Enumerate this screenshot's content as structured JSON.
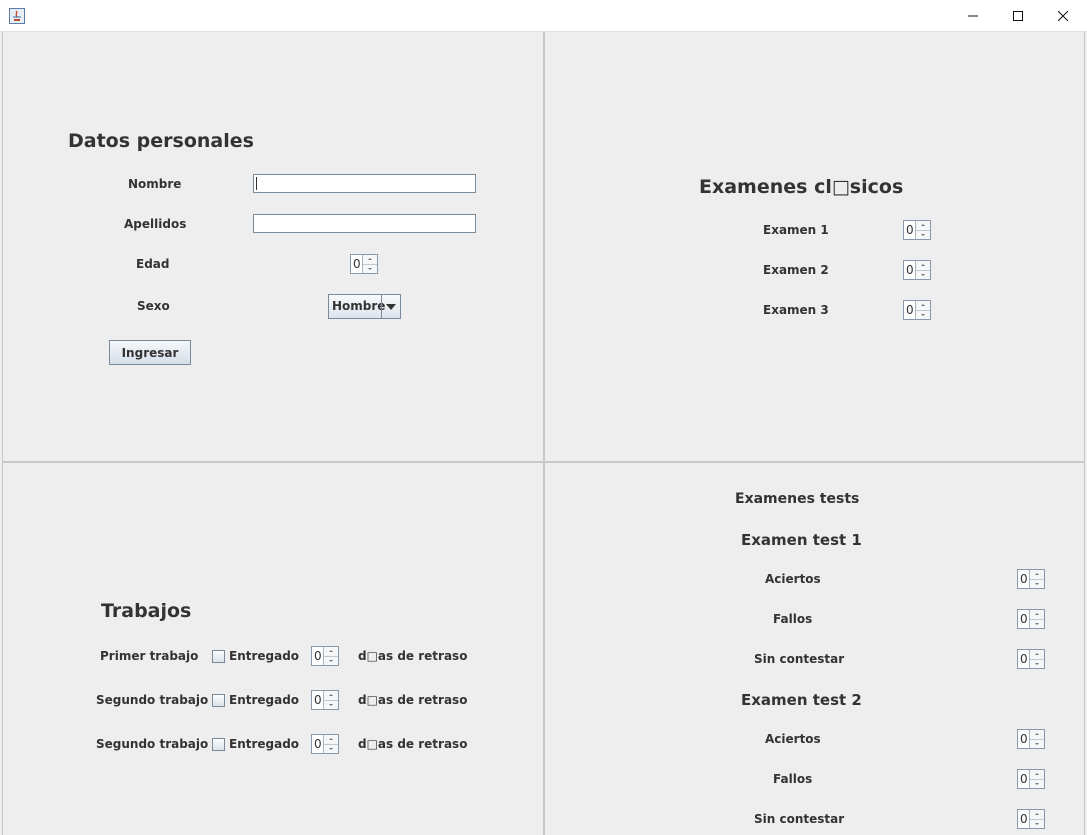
{
  "window": {
    "minimize_icon": "minimize-icon",
    "maximize_icon": "maximize-icon",
    "close_icon": "close-icon"
  },
  "datos": {
    "title": "Datos personales",
    "nombre_label": "Nombre",
    "nombre_value": "",
    "apellidos_label": "Apellidos",
    "apellidos_value": "",
    "edad_label": "Edad",
    "edad_value": "0",
    "sexo_label": "Sexo",
    "sexo_value": "Hombre",
    "ingresar_label": "Ingresar"
  },
  "clasicos": {
    "title": "Examenes cl□sicos",
    "items": [
      {
        "label": "Examen 1",
        "value": "0"
      },
      {
        "label": "Examen 2",
        "value": "0"
      },
      {
        "label": "Examen 3",
        "value": "0"
      }
    ]
  },
  "trabajos": {
    "title": "Trabajos",
    "rows": [
      {
        "label": "Primer trabajo",
        "check_label": "Entregado",
        "checked": false,
        "value": "0",
        "suffix": "d□as de retraso"
      },
      {
        "label": "Segundo trabajo",
        "check_label": "Entregado",
        "checked": false,
        "value": "0",
        "suffix": "d□as de retraso"
      },
      {
        "label": "Segundo trabajo",
        "check_label": "Entregado",
        "checked": false,
        "value": "0",
        "suffix": "d□as de retraso"
      }
    ]
  },
  "tests": {
    "title": "Examenes tests",
    "test1": {
      "title": "Examen test 1",
      "aciertos_label": "Aciertos",
      "aciertos_value": "0",
      "fallos_label": "Fallos",
      "fallos_value": "0",
      "sin_label": "Sin contestar",
      "sin_value": "0"
    },
    "test2": {
      "title": "Examen test 2",
      "aciertos_label": "Aciertos",
      "aciertos_value": "0",
      "fallos_label": "Fallos",
      "fallos_value": "0",
      "sin_label": "Sin contestar",
      "sin_value": "0"
    }
  }
}
